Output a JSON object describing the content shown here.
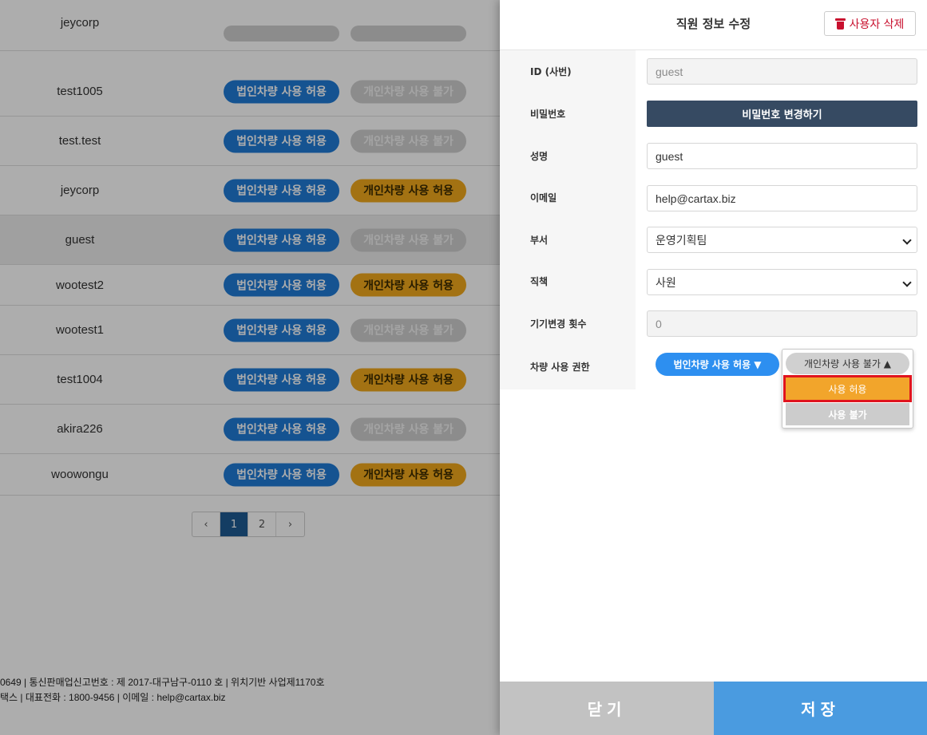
{
  "list": {
    "partial_row": {
      "user_id": "jeycorp"
    },
    "rows": [
      {
        "user_id": "test1005",
        "corp": "법인차량 사용 허용",
        "personal": "개인차량 사용 불가",
        "personal_allowed": false
      },
      {
        "user_id": "test.test",
        "corp": "법인차량 사용 허용",
        "personal": "개인차량 사용 불가",
        "personal_allowed": false
      },
      {
        "user_id": "jeycorp",
        "corp": "법인차량 사용 허용",
        "personal": "개인차량 사용 허용",
        "personal_allowed": true
      },
      {
        "user_id": "guest",
        "corp": "법인차량 사용 허용",
        "personal": "개인차량 사용 불가",
        "personal_allowed": false
      },
      {
        "user_id": "wootest2",
        "corp": "법인차량 사용 허용",
        "personal": "개인차량 사용 허용",
        "personal_allowed": true
      },
      {
        "user_id": "wootest1",
        "corp": "법인차량 사용 허용",
        "personal": "개인차량 사용 불가",
        "personal_allowed": false
      },
      {
        "user_id": "test1004",
        "corp": "법인차량 사용 허용",
        "personal": "개인차량 사용 허용",
        "personal_allowed": true
      },
      {
        "user_id": "akira226",
        "corp": "법인차량 사용 허용",
        "personal": "개인차량 사용 불가",
        "personal_allowed": false
      },
      {
        "user_id": "woowongu",
        "corp": "법인차량 사용 허용",
        "personal": "개인차량 사용 허용",
        "personal_allowed": true
      }
    ],
    "pagination": {
      "prev": "‹",
      "pages": [
        "1",
        "2"
      ],
      "current": "1",
      "next": "›"
    }
  },
  "footer": {
    "line1": "0649 | 통신판매업신고번호 : 제 2017-대구남구-0110 호 | 위치기반 사업제1170호",
    "line2": "택스 | 대표전화 : 1800-9456 | 이메일 : help@cartax.biz"
  },
  "modal": {
    "title": "직원 정보 수정",
    "delete_label": "사용자 삭제",
    "delete_icon": "trash-icon",
    "fields": {
      "id_label": "ID (사번)",
      "id_value": "guest",
      "password_label": "비밀번호",
      "password_button": "비밀번호 변경하기",
      "name_label": "성명",
      "name_value": "guest",
      "email_label": "이메일",
      "email_value": "help@cartax.biz",
      "dept_label": "부서",
      "dept_value": "운영기획팀",
      "position_label": "직책",
      "position_value": "사원",
      "device_change_label": "기기변경 횟수",
      "device_change_value": "0",
      "vehicle_label": "차량 사용 권한"
    },
    "permission": {
      "corp_button": "법인차량 사용 허용 ▼",
      "personal_toggle": "개인차량 사용 불가 ▲",
      "options": [
        "사용 허용",
        "사용 불가"
      ],
      "highlighted_option": "사용 허용"
    },
    "close_label": "닫기",
    "save_label": "저장"
  },
  "colors": {
    "corp_pill": "#1f7bd6",
    "personal_allowed": "#f0a81c",
    "personal_denied": "#cfcfcf",
    "password_button": "#364a62",
    "save_button": "#4a9be0",
    "close_button": "#c2c2c2",
    "highlight_outline": "#e0141e"
  }
}
